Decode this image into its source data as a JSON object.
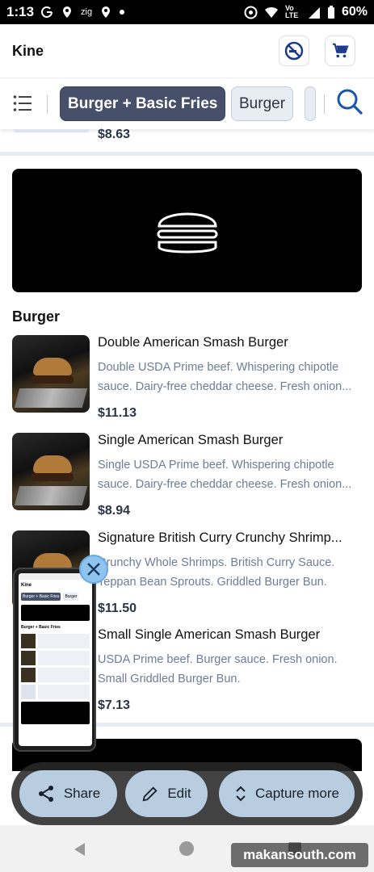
{
  "status": {
    "time": "1:13",
    "icons": [
      "google-icon",
      "location-icon",
      "zig-icon",
      "location-icon",
      "dot-icon"
    ],
    "zig_label": "zig",
    "network": "Vo LTE",
    "battery": "60%"
  },
  "header": {
    "title": "Kine",
    "buttons": [
      "no-smoking-icon",
      "cart-icon"
    ]
  },
  "categories": {
    "active": "Burger + Basic Fries",
    "items": [
      "Burger"
    ]
  },
  "previous_item": {
    "price": "$8.63"
  },
  "section": {
    "title": "Burger"
  },
  "items": [
    {
      "name": "Double American Smash Burger",
      "desc": "Double USDA Prime beef. Whispering chipotle sauce. Dairy-free cheddar cheese. Fresh onion...",
      "price": "$11.13"
    },
    {
      "name": "Single American Smash Burger",
      "desc": "Single USDA Prime beef. Whispering chipotle sauce. Dairy-free cheddar cheese. Fresh onion...",
      "price": "$8.94"
    },
    {
      "name": "Signature British Curry Crunchy Shrimp...",
      "desc": "Crunchy Whole Shrimps. British Curry Sauce. Teppan Bean Sprouts. Griddled Burger Bun.",
      "price": "$11.50"
    },
    {
      "name": "Small Single American Smash Burger",
      "desc": "USDA Prime beef. Burger sauce. Fresh onion. Small Griddled Burger Bun.",
      "price": "$7.13"
    }
  ],
  "preview": {
    "title": "Kine",
    "chip_active": "Burger + Basic Fries",
    "chip": "Burger",
    "section": "Burger + Basic Fries"
  },
  "actions": {
    "share": "Share",
    "edit": "Edit",
    "capture": "Capture more"
  },
  "watermark": "makansouth.com",
  "colors": {
    "accent_chip": "#47506a",
    "price": "#2b3447",
    "desc": "#6e7c99",
    "search": "#1a56b0"
  }
}
